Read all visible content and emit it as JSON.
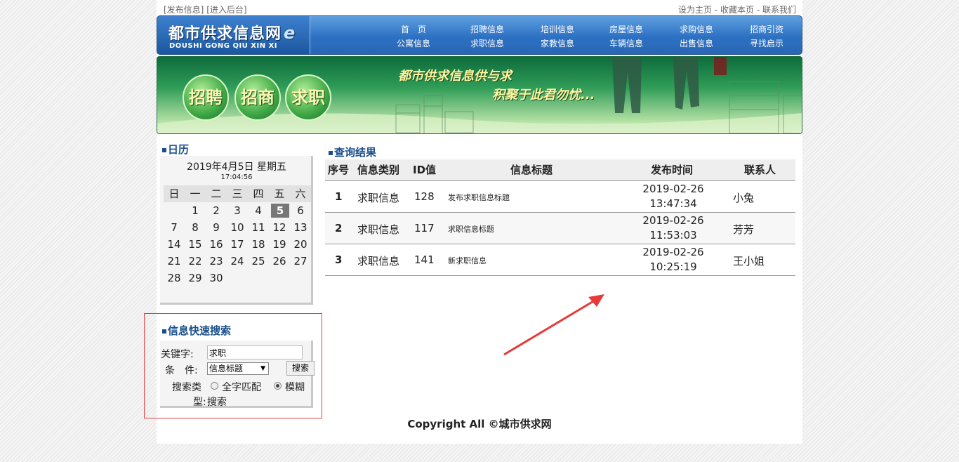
{
  "topbar": {
    "left_links": [
      "[发布信息]",
      "[进入后台]"
    ],
    "right_links": [
      "设为主页",
      "收藏本页",
      "联系我们"
    ],
    "sep": "-"
  },
  "logo": {
    "name": "都市供求信息网",
    "e": "e",
    "pinyin": "DOUSHI GONG QIU XIN XI"
  },
  "nav": [
    [
      "首　页",
      "公寓信息"
    ],
    [
      "招聘信息",
      "求职信息"
    ],
    [
      "培训信息",
      "家教信息"
    ],
    [
      "房屋信息",
      "车辆信息"
    ],
    [
      "求购信息",
      "出售信息"
    ],
    [
      "招商引资",
      "寻找启示"
    ]
  ],
  "banner": {
    "bubbles": [
      "招聘",
      "招商",
      "求职"
    ],
    "slogan1": "都市供求信息供与求",
    "slogan2": "积聚于此君勿忧..."
  },
  "calendar": {
    "title": "日历",
    "date": "2019年4月5日 星期五",
    "time": "17:04:56",
    "weekdays": [
      "日",
      "一",
      "二",
      "三",
      "四",
      "五",
      "六"
    ],
    "weeks": [
      [
        "",
        "1",
        "2",
        "3",
        "4",
        "5",
        "6"
      ],
      [
        "7",
        "8",
        "9",
        "10",
        "11",
        "12",
        "13"
      ],
      [
        "14",
        "15",
        "16",
        "17",
        "18",
        "19",
        "20"
      ],
      [
        "21",
        "22",
        "23",
        "24",
        "25",
        "26",
        "27"
      ],
      [
        "28",
        "29",
        "30",
        "",
        "",
        "",
        ""
      ]
    ],
    "today": "5"
  },
  "quick_search": {
    "title": "信息快速搜索",
    "keyword_label": "关键字:",
    "keyword_value": "求职",
    "condition_label": "条　件:",
    "condition_value": "信息标题",
    "search_button": "搜索",
    "type_label_1": "搜索类",
    "type_label_2": "型:",
    "option_exact": "全字匹配",
    "option_fuzzy_1": "模糊",
    "option_fuzzy_2": "搜索",
    "selected": "fuzzy"
  },
  "results": {
    "title": "查询结果",
    "columns": [
      "序号",
      "信息类别",
      "ID值",
      "信息标题",
      "发布时间",
      "联系人"
    ],
    "rows": [
      {
        "no": "1",
        "category": "求职信息",
        "id": "128",
        "title": "发布求职信息标题",
        "date": "2019-02-26",
        "time": "13:47:34",
        "contact": "小兔"
      },
      {
        "no": "2",
        "category": "求职信息",
        "id": "117",
        "title": "求职信息标题",
        "date": "2019-02-26",
        "time": "11:53:03",
        "contact": "芳芳"
      },
      {
        "no": "3",
        "category": "求职信息",
        "id": "141",
        "title": "新求职信息",
        "date": "2019-02-26",
        "time": "10:25:19",
        "contact": "王小姐"
      }
    ]
  },
  "footer": {
    "copyright": "Copyright All ©城市供求网"
  },
  "colors": {
    "annotation_red": "#e63a3a",
    "header_blue": "#2d71c3",
    "title_blue": "#1a4f8c"
  }
}
